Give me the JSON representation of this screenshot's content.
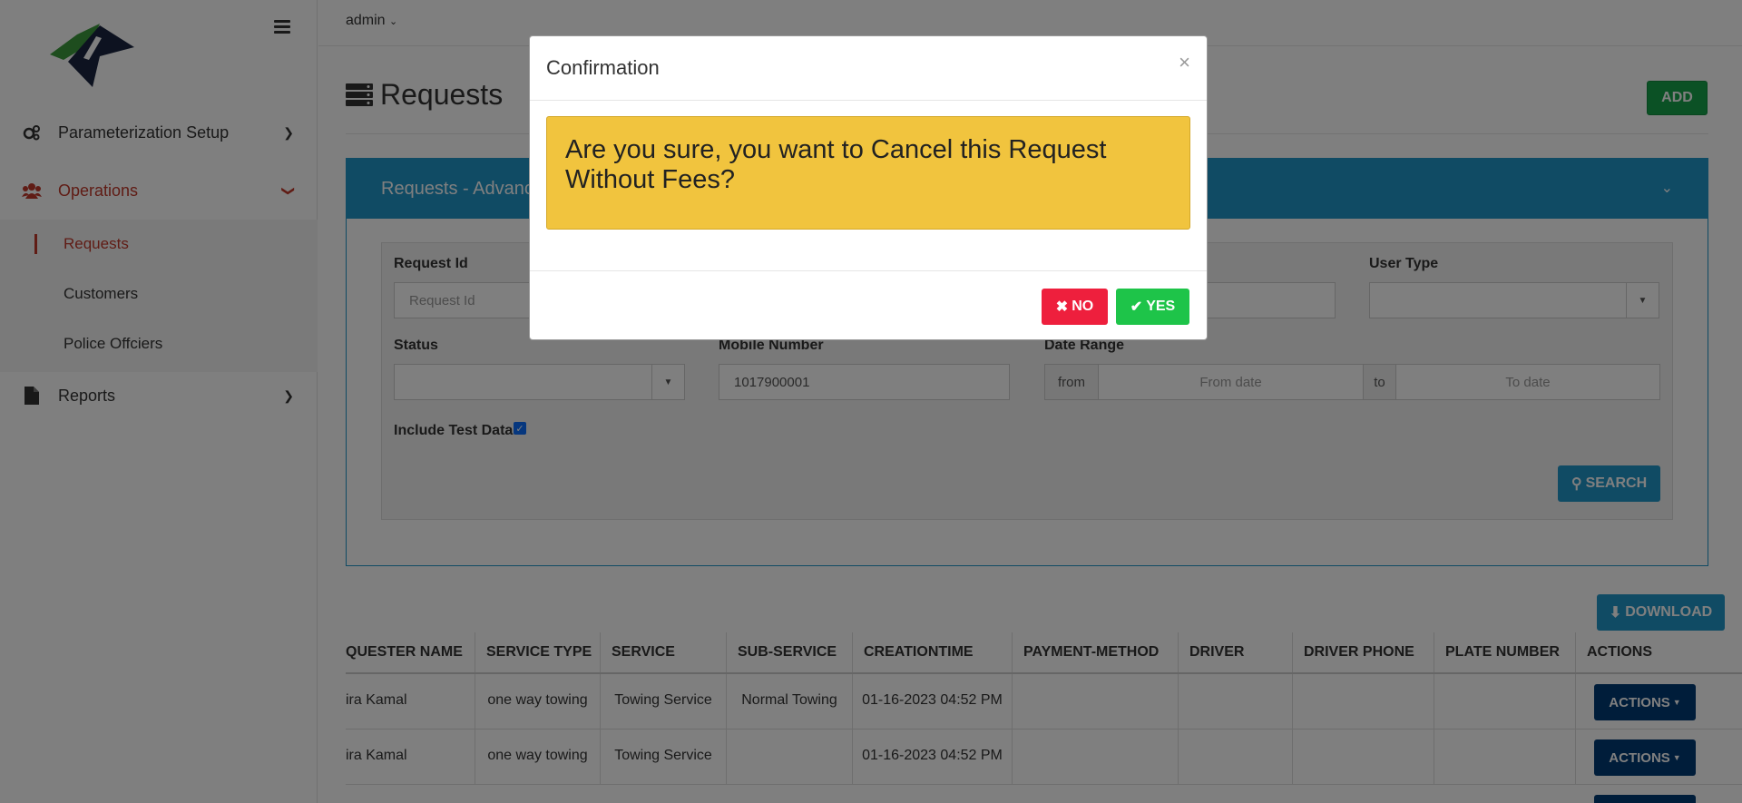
{
  "user": {
    "name": "admin"
  },
  "sidebar": {
    "items": [
      {
        "label": "Parameterization Setup"
      },
      {
        "label": "Operations"
      },
      {
        "label": "Reports"
      }
    ],
    "sub_items": [
      {
        "label": "Requests"
      },
      {
        "label": "Customers"
      },
      {
        "label": "Police Offciers"
      }
    ]
  },
  "page": {
    "title": "Requests",
    "add_label": "ADD"
  },
  "filters": {
    "panel_title": "Requests - Advanc",
    "request_id_label": "Request Id",
    "request_id_placeholder": "Request Id",
    "user_type_label": "User Type",
    "status_label": "Status",
    "mobile_label": "Mobile Number",
    "mobile_value": "1017900001",
    "date_range_label": "Date Range",
    "from_addon": "from",
    "from_placeholder": "From date",
    "to_addon": "to",
    "to_placeholder": "To date",
    "include_test_label": "Include Test Data",
    "search_label": "SEARCH"
  },
  "download_label": "DOWNLOAD",
  "table": {
    "headers": [
      "QUESTER NAME",
      "SERVICE TYPE",
      "SERVICE",
      "SUB-SERVICE",
      "CREATIONTIME",
      "PAYMENT-METHOD",
      "DRIVER",
      "DRIVER PHONE",
      "PLATE NUMBER",
      "ACTIONS"
    ],
    "rows": [
      {
        "requester": "ira Kamal",
        "service_type": "one way towing",
        "service": "Towing Service",
        "sub_service": "Normal Towing",
        "creation": "01-16-2023 04:52 PM",
        "action": "ACTIONS"
      },
      {
        "requester": "ira Kamal",
        "service_type": "one way towing",
        "service": "Towing Service",
        "sub_service": "",
        "creation": "01-16-2023 04:52 PM",
        "action": "ACTIONS"
      }
    ]
  },
  "modal": {
    "title": "Confirmation",
    "message": "Are you sure, you want to Cancel this Request Without Fees?",
    "no_label": "NO",
    "yes_label": "YES"
  }
}
